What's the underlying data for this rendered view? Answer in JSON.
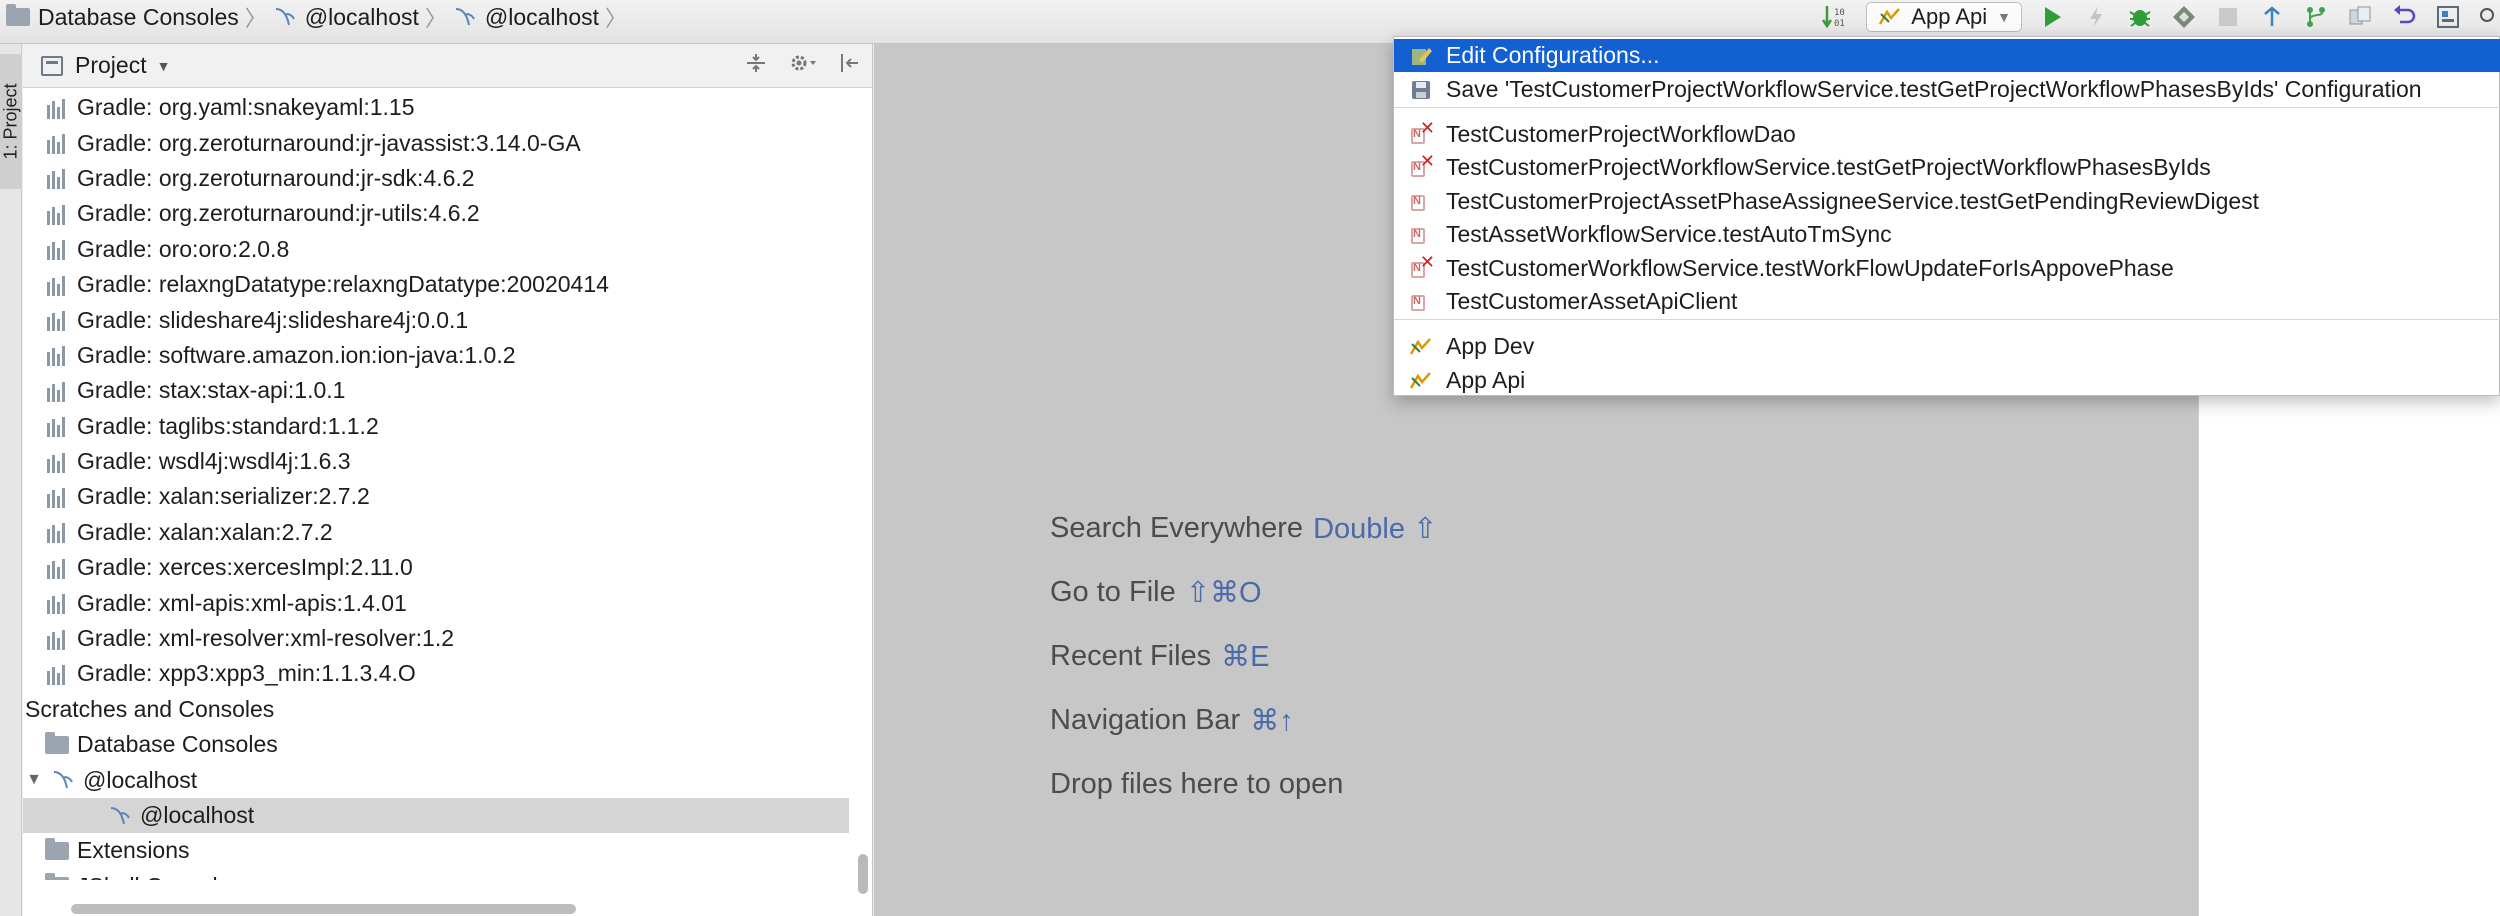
{
  "breadcrumbs": [
    {
      "label": "Database Consoles",
      "icon": "folder-icon"
    },
    {
      "label": "@localhost",
      "icon": "mysql-icon"
    },
    {
      "label": "@localhost",
      "icon": "mysql-icon"
    }
  ],
  "toolbar": {
    "run_config_label": "App Api",
    "icons": [
      "sort-icon",
      "run-icon",
      "lightning-icon",
      "debug-icon",
      "coverage-icon",
      "stop-icon",
      "vcs-update-icon",
      "vcs-commit-icon",
      "vcs-compare-icon",
      "undo-icon",
      "structure-icon",
      "search-icon"
    ]
  },
  "left_strip": {
    "tab_label": "1: Project"
  },
  "project_panel": {
    "title": "Project",
    "rows": [
      {
        "label": "Gradle: org.yaml:snakeyaml:1.15",
        "kind": "lib",
        "indent": 0
      },
      {
        "label": "Gradle: org.zeroturnaround:jr-javassist:3.14.0-GA",
        "kind": "lib",
        "indent": 0
      },
      {
        "label": "Gradle: org.zeroturnaround:jr-sdk:4.6.2",
        "kind": "lib",
        "indent": 0
      },
      {
        "label": "Gradle: org.zeroturnaround:jr-utils:4.6.2",
        "kind": "lib",
        "indent": 0
      },
      {
        "label": "Gradle: oro:oro:2.0.8",
        "kind": "lib",
        "indent": 0
      },
      {
        "label": "Gradle: relaxngDatatype:relaxngDatatype:20020414",
        "kind": "lib",
        "indent": 0
      },
      {
        "label": "Gradle: slideshare4j:slideshare4j:0.0.1",
        "kind": "lib",
        "indent": 0
      },
      {
        "label": "Gradle: software.amazon.ion:ion-java:1.0.2",
        "kind": "lib",
        "indent": 0
      },
      {
        "label": "Gradle: stax:stax-api:1.0.1",
        "kind": "lib",
        "indent": 0
      },
      {
        "label": "Gradle: taglibs:standard:1.1.2",
        "kind": "lib",
        "indent": 0
      },
      {
        "label": "Gradle: wsdl4j:wsdl4j:1.6.3",
        "kind": "lib",
        "indent": 0
      },
      {
        "label": "Gradle: xalan:serializer:2.7.2",
        "kind": "lib",
        "indent": 0
      },
      {
        "label": "Gradle: xalan:xalan:2.7.2",
        "kind": "lib",
        "indent": 0
      },
      {
        "label": "Gradle: xerces:xercesImpl:2.11.0",
        "kind": "lib",
        "indent": 0
      },
      {
        "label": "Gradle: xml-apis:xml-apis:1.4.01",
        "kind": "lib",
        "indent": 0
      },
      {
        "label": "Gradle: xml-resolver:xml-resolver:1.2",
        "kind": "lib",
        "indent": 0
      },
      {
        "label": "Gradle: xpp3:xpp3_min:1.1.3.4.O",
        "kind": "lib",
        "indent": 0
      },
      {
        "label": "Scratches and Consoles",
        "kind": "plain",
        "indent": -1
      },
      {
        "label": "Database Consoles",
        "kind": "folder",
        "indent": 0
      },
      {
        "label": "@localhost",
        "kind": "mysql",
        "indent": 0,
        "expanded": true
      },
      {
        "label": "@localhost",
        "kind": "mysql",
        "indent": 1,
        "selected": true
      },
      {
        "label": "Extensions",
        "kind": "folder",
        "indent": 0
      },
      {
        "label": "JShell Console",
        "kind": "folder",
        "indent": 0
      }
    ]
  },
  "editor_hints": [
    {
      "text": "Search Everywhere",
      "key": "Double ⇧"
    },
    {
      "text": "Go to File",
      "key": "⇧⌘O"
    },
    {
      "text": "Recent Files",
      "key": "⌘E"
    },
    {
      "text": "Navigation Bar",
      "key": "⌘↑"
    },
    {
      "text": "Drop files here to open",
      "key": ""
    }
  ],
  "popup": {
    "items": [
      {
        "label": "Edit Configurations...",
        "icon": "edit-config-icon",
        "active": true
      },
      {
        "label": "Save 'TestCustomerProjectWorkflowService.testGetProjectWorkflowPhasesByIds' Configuration",
        "icon": "save-icon"
      },
      {
        "label": "TestCustomerProjectWorkflowDao",
        "icon": "test-failed-icon"
      },
      {
        "label": "TestCustomerProjectWorkflowService.testGetProjectWorkflowPhasesByIds",
        "icon": "test-failed-icon"
      },
      {
        "label": "TestCustomerProjectAssetPhaseAssigneeService.testGetPendingReviewDigest",
        "icon": "test-icon"
      },
      {
        "label": "TestAssetWorkflowService.testAutoTmSync",
        "icon": "test-icon"
      },
      {
        "label": "TestCustomerWorkflowService.testWorkFlowUpdateForIsAppovePhase",
        "icon": "test-failed-icon"
      },
      {
        "label": "TestCustomerAssetApiClient",
        "icon": "test-icon"
      },
      {
        "label": "App Dev",
        "icon": "spring-app-icon"
      },
      {
        "label": "App Api",
        "icon": "spring-app-icon"
      }
    ]
  },
  "colors": {
    "accent": "#1260d1",
    "editor_bg": "#c7c7c7",
    "hint_key": "#4a6aa8",
    "selected_row": "#d5d5d5"
  }
}
